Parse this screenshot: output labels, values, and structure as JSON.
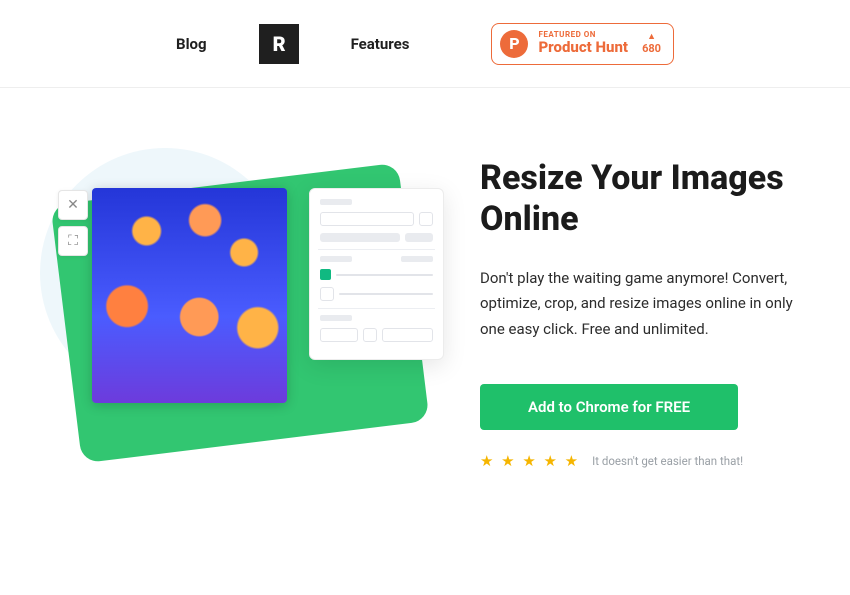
{
  "nav": {
    "blog": "Blog",
    "features": "Features",
    "logo_letter": "R"
  },
  "ph": {
    "letter": "P",
    "featured": "FEATURED ON",
    "name": "Product Hunt",
    "triangle": "▲",
    "count": "680"
  },
  "hero": {
    "title": "Resize Your Images Online",
    "lead": "Don't play the waiting game anymore! Convert, optimize, crop, and resize images online in only one easy click. Free and unlimited.",
    "cta": "Add to Chrome for FREE",
    "stars": "★ ★ ★ ★ ★",
    "rating_text": "It doesn't get easier than that!"
  },
  "tools": {
    "close": "✕",
    "crop": "⛶"
  }
}
